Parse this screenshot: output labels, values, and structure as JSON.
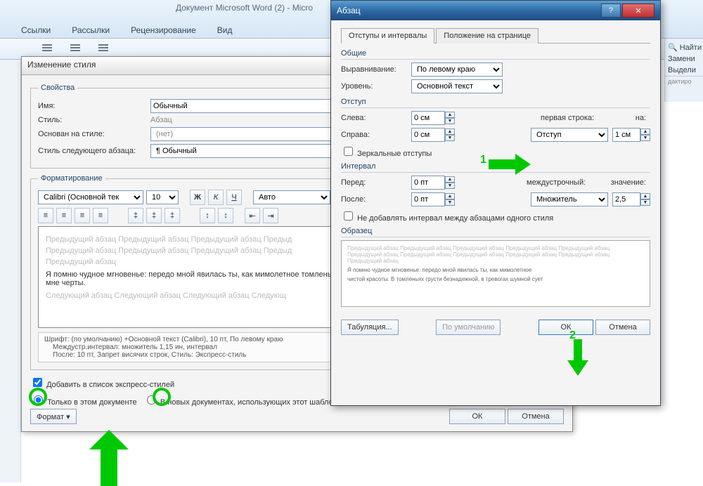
{
  "app_title": "Документ Microsoft Word (2) - Micro",
  "ribbon_tabs": [
    "Ссылки",
    "Рассылки",
    "Рецензирование",
    "Вид"
  ],
  "right_pane": {
    "find": "Найти",
    "replace": "Замени",
    "select": "Выдели",
    "editing": "дактиро"
  },
  "style_dlg": {
    "title": "Изменение стиля",
    "props_legend": "Свойства",
    "name_lbl": "Имя:",
    "name_val": "Обычный",
    "type_lbl": "Стиль:",
    "type_val": "Абзац",
    "based_lbl": "Основан на стиле:",
    "based_val": "(нет)",
    "next_lbl": "Стиль следующего абзаца:",
    "next_val": "¶ Обычный",
    "fmt_legend": "Форматирование",
    "font_name": "Calibri (Основной тек",
    "font_size": "10",
    "auto": "Авто",
    "preview_gray1": "Предыдущий абзац Предыдущий абзац Предыдущий абзац Предыд",
    "preview_gray2": "Предыдущий абзац Предыдущий абзац Предыдущий абзац Предыд",
    "preview_gray3": "Предыдущий абзац",
    "preview_black": "Я помню чудное мгновенье: передо мной явилась ты, как мимолетное томленьях грусти безнадежной, в тревогах шумной суеты, звучал мне черты.",
    "preview_gray4": "Следующий абзац Следующий абзац Следующий абзац Следующ",
    "desc1": "Шрифт: (по умолчанию) +Основной текст (Calibri), 10 пт, По левому краю",
    "desc2": "Междустр.интервал:  множитель 1,15 ин, интервал",
    "desc3": "После:  10 пт, Запрет висячих строк, Стиль: Экспресс-стиль",
    "chk_quick": "Добавить в список экспресс-стилей",
    "radio_this": "Только в этом документе",
    "radio_new": "В новых документах, использующих этот шаблон",
    "format_btn": "Формат ▾",
    "ok": "ОК",
    "cancel": "Отмена"
  },
  "para_dlg": {
    "title": "Абзац",
    "tab1": "Отступы и интервалы",
    "tab2": "Положение на странице",
    "grp_general": "Общие",
    "align_lbl": "Выравнивание:",
    "align_val": "По левому краю",
    "level_lbl": "Уровень:",
    "level_val": "Основной текст",
    "grp_indent": "Отступ",
    "left_lbl": "Слева:",
    "left_val": "0 см",
    "right_lbl": "Справа:",
    "right_val": "0 см",
    "first_lbl": "первая строка:",
    "first_val": "Отступ",
    "by_lbl": "на:",
    "by_val": "1 см",
    "mirror": "Зеркальные отступы",
    "grp_spacing": "Интервал",
    "before_lbl": "Перед:",
    "before_val": "0 пт",
    "after_lbl": "После:",
    "after_val": "0 пт",
    "line_lbl": "междустрочный:",
    "line_val": "Множитель",
    "at_lbl": "значение:",
    "at_val": "2,5",
    "nosame": "Не добавлять интервал между абзацами одного стиля",
    "grp_sample": "Образец",
    "sample1": "Предыдущий абзац Предыдущий абзац Предыдущий абзац Предыдущий абзац Предыдущий абзац",
    "sample2": "Предыдущий абзац Предыдущий абзац Предыдущий абзац Предыдущий абзац Предыдущий абзац",
    "sample3": "Предыдущий абзац",
    "sample4": "Я помню чудное мгновенье: передо мной явилась ты, как мимолетное",
    "sample5": "чистой красоты. В томленьях грусти безнадежной, в тревогах шумной сует",
    "tabs_btn": "Табуляция...",
    "default_btn": "По умолчанию",
    "ok": "ОК",
    "cancel": "Отмена",
    "anno1": "1",
    "anno2": "2"
  }
}
